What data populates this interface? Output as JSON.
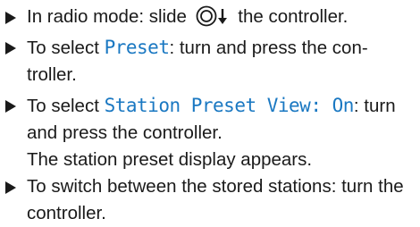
{
  "steps": [
    {
      "before": "In radio mode: slide ",
      "icon": "controller-slide-down-icon",
      "after": " the controller."
    },
    {
      "before": "To select ",
      "highlight": "Preset",
      "after": ": turn and press the con-troller."
    },
    {
      "before": "To select ",
      "highlight": "Station Preset View: On",
      "after": ": turn and press the controller.",
      "result": "The station preset display appears."
    },
    {
      "text": "To switch between the stored stations: turn the controller."
    }
  ],
  "colors": {
    "display_text": "#1a78c2",
    "text": "#1a1a1a"
  }
}
